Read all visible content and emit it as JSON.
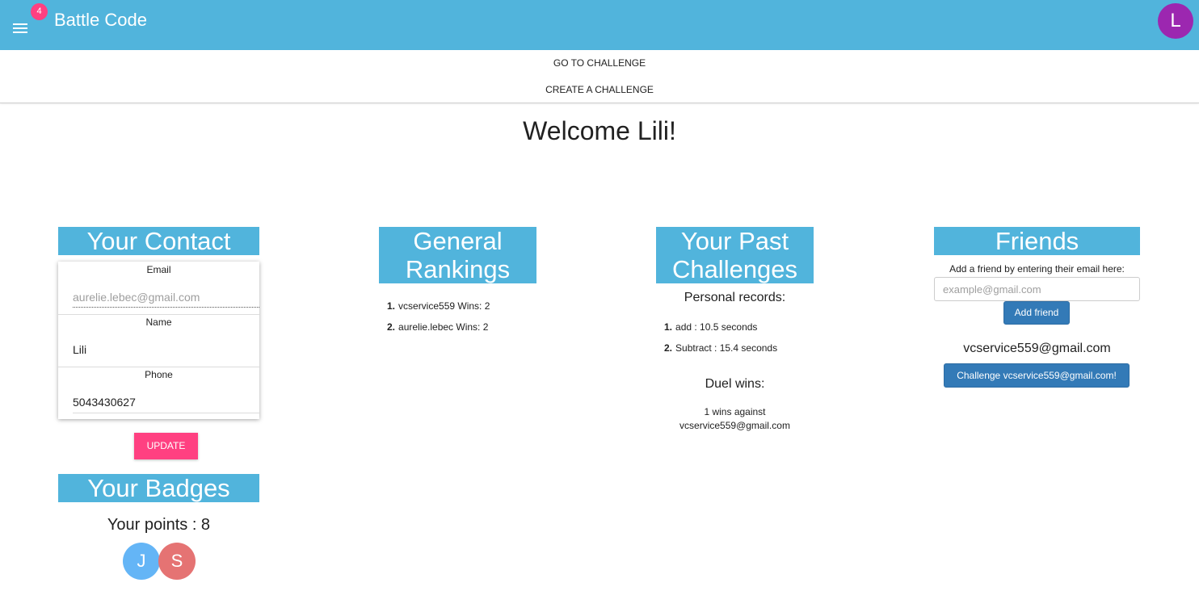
{
  "header": {
    "notification_count": "4",
    "title": "Battle Code",
    "avatar_initial": "L",
    "brand_color": "#51b4dc"
  },
  "nav": {
    "go_to_challenge": "GO TO CHALLENGE",
    "create_challenge": "CREATE A CHALLENGE"
  },
  "welcome": "Welcome Lili!",
  "contact": {
    "heading": "Your Contact",
    "email_label": "Email",
    "email_placeholder": "aurelie.lebec@gmail.com",
    "name_label": "Name",
    "name_value": "Lili",
    "phone_label": "Phone",
    "phone_value": "5043430627",
    "update_label": "UPDATE"
  },
  "badges": {
    "heading": "Your Badges",
    "points_text": "Your points : 8",
    "items": [
      {
        "initial": "J",
        "color": "#64b5f6"
      },
      {
        "initial": "S",
        "color": "#e57373"
      }
    ]
  },
  "rankings": {
    "heading_line1": "General",
    "heading_line2": "Rankings",
    "items": [
      {
        "num": "1.",
        "text": "vcservice559 Wins: 2"
      },
      {
        "num": "2.",
        "text": "aurelie.lebec Wins: 2"
      }
    ]
  },
  "past": {
    "heading_line1": "Your Past",
    "heading_line2": "Challenges",
    "records_title": "Personal records:",
    "records": [
      {
        "num": "1.",
        "text": "add : 10.5 seconds"
      },
      {
        "num": "2.",
        "text": "Subtract : 15.4 seconds"
      }
    ],
    "duel_title": "Duel wins:",
    "duel_line1": "1 wins against",
    "duel_line2": "vcservice559@gmail.com"
  },
  "friends": {
    "heading": "Friends",
    "prompt": "Add a friend by entering their email here:",
    "input_placeholder": "example@gmail.com",
    "add_label": "Add friend",
    "friend_email": "vcservice559@gmail.com",
    "challenge_label": "Challenge vcservice559@gmail.com!"
  }
}
